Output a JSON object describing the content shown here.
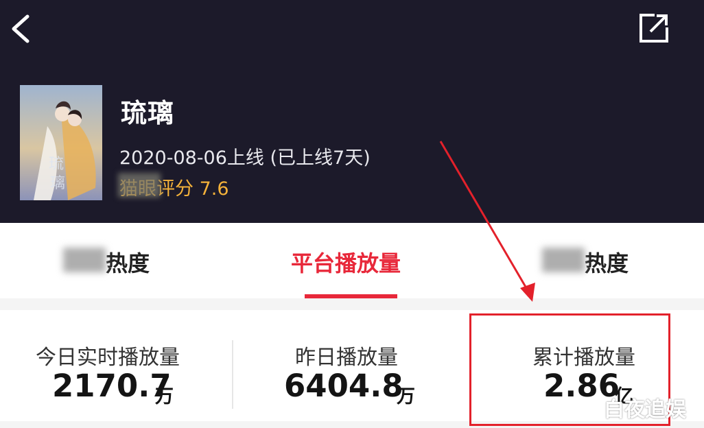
{
  "header": {
    "title": "琉璃",
    "release": "2020-08-06上线 (已上线7天)",
    "score_label": "猫眼评分",
    "score_value": "7.6",
    "back_icon": "chevron-left-icon",
    "share_icon": "share-icon"
  },
  "tabs": [
    {
      "label": "热度",
      "blurred_prefix": true
    },
    {
      "label": "平台播放量",
      "active": true
    },
    {
      "label": "热度",
      "blurred_prefix": true
    }
  ],
  "stats": [
    {
      "label": "今日实时播放量",
      "value": "2170.7",
      "unit": "万"
    },
    {
      "label": "昨日播放量",
      "value": "6404.8",
      "unit": "万"
    },
    {
      "label": "累计播放量",
      "value": "2.86",
      "unit": "亿"
    }
  ],
  "watermark": "白夜追娱",
  "colors": {
    "accent": "#e8283a",
    "header_bg": "#1c1a2a",
    "score": "#f4b23a",
    "annotation": "#e3212b"
  }
}
